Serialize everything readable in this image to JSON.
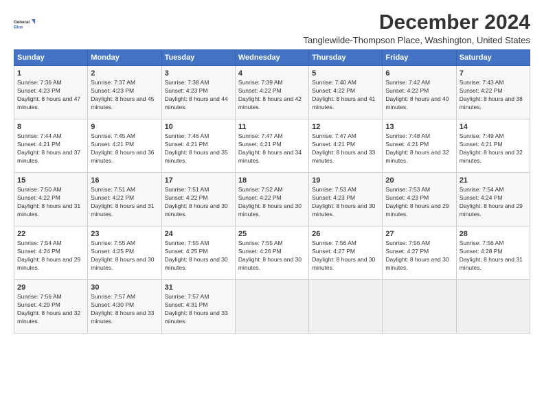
{
  "logo": {
    "line1": "General",
    "line2": "Blue"
  },
  "title": "December 2024",
  "subtitle": "Tanglewilde-Thompson Place, Washington, United States",
  "days_of_week": [
    "Sunday",
    "Monday",
    "Tuesday",
    "Wednesday",
    "Thursday",
    "Friday",
    "Saturday"
  ],
  "weeks": [
    [
      {
        "day": 1,
        "sunrise": "7:36 AM",
        "sunset": "4:23 PM",
        "daylight": "8 hours and 47 minutes."
      },
      {
        "day": 2,
        "sunrise": "7:37 AM",
        "sunset": "4:23 PM",
        "daylight": "8 hours and 45 minutes."
      },
      {
        "day": 3,
        "sunrise": "7:38 AM",
        "sunset": "4:23 PM",
        "daylight": "8 hours and 44 minutes."
      },
      {
        "day": 4,
        "sunrise": "7:39 AM",
        "sunset": "4:22 PM",
        "daylight": "8 hours and 42 minutes."
      },
      {
        "day": 5,
        "sunrise": "7:40 AM",
        "sunset": "4:22 PM",
        "daylight": "8 hours and 41 minutes."
      },
      {
        "day": 6,
        "sunrise": "7:42 AM",
        "sunset": "4:22 PM",
        "daylight": "8 hours and 40 minutes."
      },
      {
        "day": 7,
        "sunrise": "7:43 AM",
        "sunset": "4:22 PM",
        "daylight": "8 hours and 38 minutes."
      }
    ],
    [
      {
        "day": 8,
        "sunrise": "7:44 AM",
        "sunset": "4:21 PM",
        "daylight": "8 hours and 37 minutes."
      },
      {
        "day": 9,
        "sunrise": "7:45 AM",
        "sunset": "4:21 PM",
        "daylight": "8 hours and 36 minutes."
      },
      {
        "day": 10,
        "sunrise": "7:46 AM",
        "sunset": "4:21 PM",
        "daylight": "8 hours and 35 minutes."
      },
      {
        "day": 11,
        "sunrise": "7:47 AM",
        "sunset": "4:21 PM",
        "daylight": "8 hours and 34 minutes."
      },
      {
        "day": 12,
        "sunrise": "7:47 AM",
        "sunset": "4:21 PM",
        "daylight": "8 hours and 33 minutes."
      },
      {
        "day": 13,
        "sunrise": "7:48 AM",
        "sunset": "4:21 PM",
        "daylight": "8 hours and 32 minutes."
      },
      {
        "day": 14,
        "sunrise": "7:49 AM",
        "sunset": "4:21 PM",
        "daylight": "8 hours and 32 minutes."
      }
    ],
    [
      {
        "day": 15,
        "sunrise": "7:50 AM",
        "sunset": "4:22 PM",
        "daylight": "8 hours and 31 minutes."
      },
      {
        "day": 16,
        "sunrise": "7:51 AM",
        "sunset": "4:22 PM",
        "daylight": "8 hours and 31 minutes."
      },
      {
        "day": 17,
        "sunrise": "7:51 AM",
        "sunset": "4:22 PM",
        "daylight": "8 hours and 30 minutes."
      },
      {
        "day": 18,
        "sunrise": "7:52 AM",
        "sunset": "4:22 PM",
        "daylight": "8 hours and 30 minutes."
      },
      {
        "day": 19,
        "sunrise": "7:53 AM",
        "sunset": "4:23 PM",
        "daylight": "8 hours and 30 minutes."
      },
      {
        "day": 20,
        "sunrise": "7:53 AM",
        "sunset": "4:23 PM",
        "daylight": "8 hours and 29 minutes."
      },
      {
        "day": 21,
        "sunrise": "7:54 AM",
        "sunset": "4:24 PM",
        "daylight": "8 hours and 29 minutes."
      }
    ],
    [
      {
        "day": 22,
        "sunrise": "7:54 AM",
        "sunset": "4:24 PM",
        "daylight": "8 hours and 29 minutes."
      },
      {
        "day": 23,
        "sunrise": "7:55 AM",
        "sunset": "4:25 PM",
        "daylight": "8 hours and 30 minutes."
      },
      {
        "day": 24,
        "sunrise": "7:55 AM",
        "sunset": "4:25 PM",
        "daylight": "8 hours and 30 minutes."
      },
      {
        "day": 25,
        "sunrise": "7:55 AM",
        "sunset": "4:26 PM",
        "daylight": "8 hours and 30 minutes."
      },
      {
        "day": 26,
        "sunrise": "7:56 AM",
        "sunset": "4:27 PM",
        "daylight": "8 hours and 30 minutes."
      },
      {
        "day": 27,
        "sunrise": "7:56 AM",
        "sunset": "4:27 PM",
        "daylight": "8 hours and 30 minutes."
      },
      {
        "day": 28,
        "sunrise": "7:56 AM",
        "sunset": "4:28 PM",
        "daylight": "8 hours and 31 minutes."
      }
    ],
    [
      {
        "day": 29,
        "sunrise": "7:56 AM",
        "sunset": "4:29 PM",
        "daylight": "8 hours and 32 minutes."
      },
      {
        "day": 30,
        "sunrise": "7:57 AM",
        "sunset": "4:30 PM",
        "daylight": "8 hours and 33 minutes."
      },
      {
        "day": 31,
        "sunrise": "7:57 AM",
        "sunset": "4:31 PM",
        "daylight": "8 hours and 33 minutes."
      },
      null,
      null,
      null,
      null
    ]
  ]
}
